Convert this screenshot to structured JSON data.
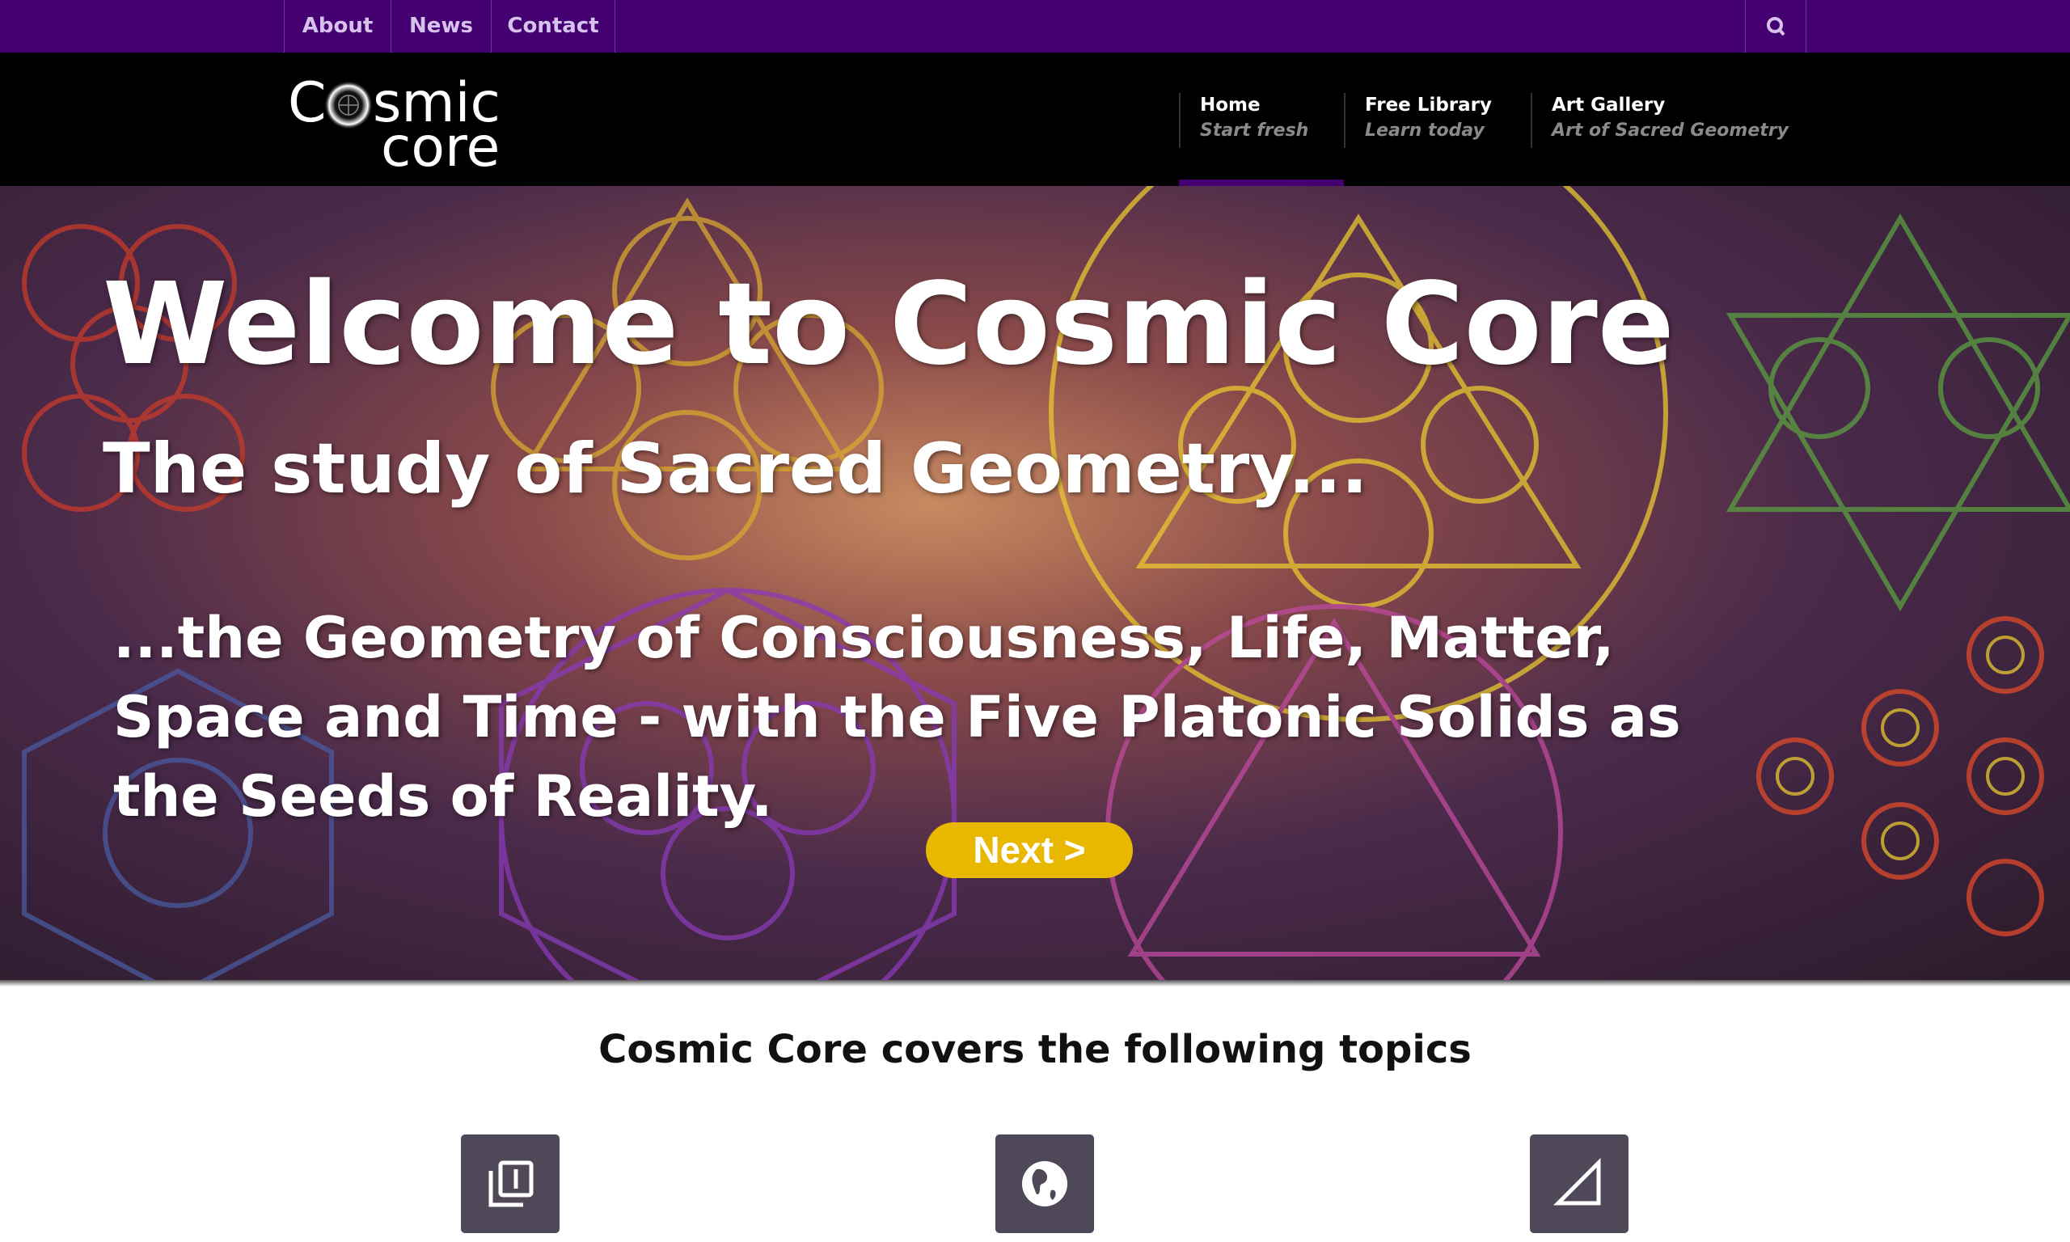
{
  "topbar": {
    "links": [
      "About",
      "News",
      "Contact"
    ],
    "search_icon": "search-icon"
  },
  "header": {
    "logo_text": "Cosmic core",
    "nav": [
      {
        "title": "Home",
        "subtitle": "Start fresh",
        "active": true
      },
      {
        "title": "Free Library",
        "subtitle": "Learn today"
      },
      {
        "title": "Art Gallery",
        "subtitle": "Art of Sacred Geometry"
      }
    ],
    "active_color": "#440070"
  },
  "hero": {
    "title": "Welcome to Cosmic Core",
    "subtitle": "The study of Sacred Geometry...",
    "text": "...the Geometry of Consciousness, Life, Matter, Space and Time - with the Five Platonic Solids as the Seeds of Reality.",
    "next_label": "Next >",
    "button_color": "#e8b800"
  },
  "topics": {
    "heading": "Cosmic Core covers the following topics",
    "icons": [
      "numbered-pages-icon",
      "globe-icon",
      "triangle-ruler-icon"
    ],
    "box_color": "#4f4859"
  }
}
